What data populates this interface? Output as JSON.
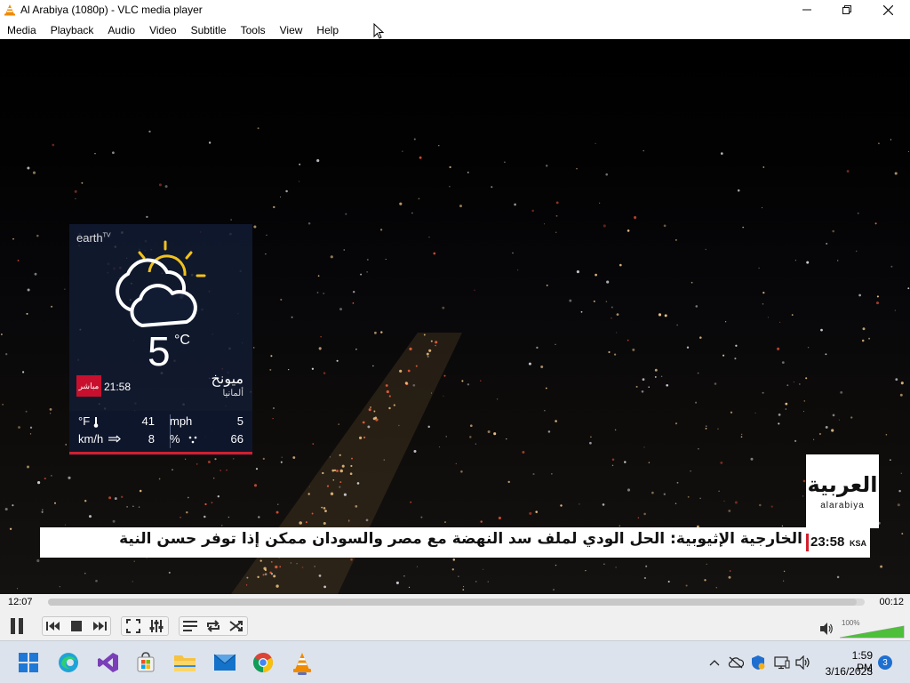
{
  "window": {
    "title": "Al Arabiya (1080p) - VLC media player",
    "controls": [
      "minimize-icon",
      "maximize-icon",
      "close-icon"
    ]
  },
  "menu": [
    {
      "label": "Media"
    },
    {
      "label": "Playback"
    },
    {
      "label": "Audio"
    },
    {
      "label": "Video"
    },
    {
      "label": "Subtitle"
    },
    {
      "label": "Tools"
    },
    {
      "label": "View"
    },
    {
      "label": "Help"
    }
  ],
  "video": {
    "weather": {
      "brand": "earth",
      "brand_sup": "TV",
      "icon": "partly-cloudy-night-icon",
      "temperature": "5",
      "unit": "°C",
      "live_badge": "مباشر",
      "time": "21:58",
      "city": "ميونخ",
      "country": "ألمانيا",
      "stats": {
        "f_label": "°F",
        "f_value": "41",
        "kmh_label": "km/h",
        "kmh_value": "8",
        "mph_label": "mph",
        "mph_value": "5",
        "humidity_label": "%",
        "humidity_value": "66"
      },
      "accent_color": "#d21f2b"
    },
    "logo": {
      "arabic": "العربية",
      "latin": "alarabiya"
    },
    "ticker": {
      "headline": "الخارجية الإثيوبية: الحل الودي لملف سد النهضة مع مصر والسودان ممكن إذا توفر حسن النية",
      "clock": "23:58",
      "zone": "KSA"
    }
  },
  "player": {
    "elapsed": "12:07",
    "remaining": "00:12",
    "progress": 0.99,
    "volume_label": "100%",
    "volume": 1.0,
    "buttons": [
      "pause-icon",
      "previous-icon",
      "stop-icon",
      "next-icon",
      "fullscreen-icon",
      "extended-settings-icon",
      "playlist-icon",
      "loop-icon",
      "shuffle-icon"
    ]
  },
  "taskbar": {
    "apps": [
      "windows-start-icon",
      "edge-icon",
      "visual-studio-icon",
      "store-icon",
      "file-explorer-icon",
      "mail-icon",
      "chrome-icon",
      "vlc-icon"
    ],
    "tray": [
      "chevron-up-icon",
      "network-icon",
      "security-icon",
      "display-icon",
      "speaker-icon"
    ],
    "time": "1:59 PM",
    "date": "3/16/2023",
    "notifications": "3"
  }
}
